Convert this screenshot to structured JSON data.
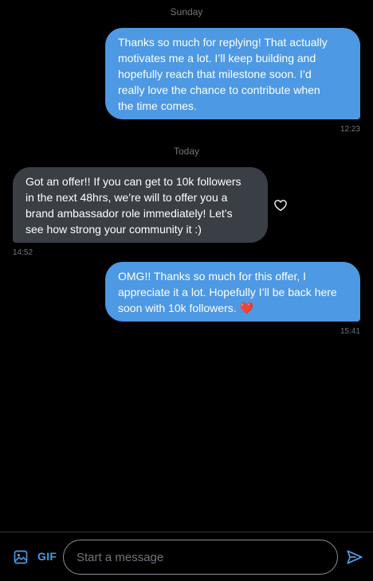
{
  "conversation": {
    "day_separators": [
      "Sunday",
      "Today"
    ],
    "messages": [
      {
        "direction": "outgoing",
        "lines": [
          "Thanks so much for replying! That actually",
          "motivates me a lot. I’ll keep building and",
          "hopefully reach that milestone soon. I’d",
          "really love the chance to contribute when",
          "the time comes."
        ],
        "time": "12:23"
      },
      {
        "direction": "incoming",
        "lines": [
          "Got an offer!! If you can get to 10k followers",
          "in the next 48hrs, we’re will to offer you a",
          "brand ambassador role immediately! Let’s",
          "see how strong your community it :)"
        ],
        "time": "14:52",
        "reaction_icon": "heart-outline-icon"
      },
      {
        "direction": "outgoing",
        "lines": [
          "OMG!! Thanks so much for this offer, I",
          "appreciate it a lot. Hopefully I’ll be back here",
          "soon with 10k followers. ❤️"
        ],
        "time": "15:41"
      }
    ]
  },
  "composer": {
    "media_icon": "image-icon",
    "gif_label": "GIF",
    "placeholder": "Start a message",
    "value": "",
    "send_icon": "send-icon"
  },
  "colors": {
    "background": "#000000",
    "outgoing_bubble": "#4d99e3",
    "incoming_bubble": "#3a3e45",
    "accent": "#4d99e3",
    "muted_text": "#71767b"
  }
}
